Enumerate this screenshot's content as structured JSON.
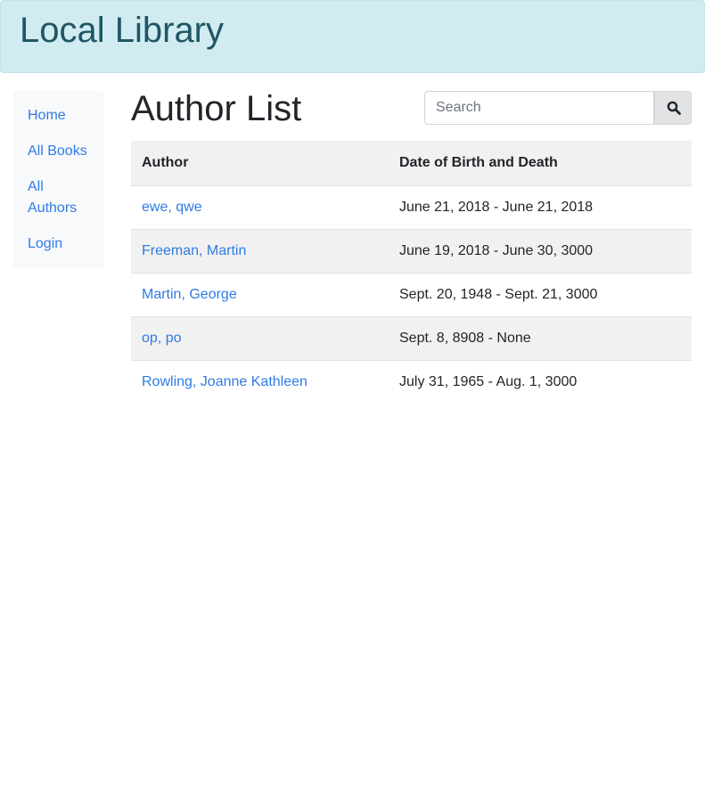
{
  "header": {
    "site_title": "Local Library",
    "banner_color": "#d1ecf1"
  },
  "sidebar": {
    "items": [
      {
        "label": "Home"
      },
      {
        "label": "All Books"
      },
      {
        "label": "All Authors"
      },
      {
        "label": "Login"
      }
    ]
  },
  "main": {
    "page_title": "Author List",
    "search": {
      "placeholder": "Search",
      "button_icon": "search-icon"
    },
    "table": {
      "columns": [
        "Author",
        "Date of Birth and Death"
      ],
      "rows": [
        {
          "author": "ewe, qwe",
          "dates": "June 21, 2018 - June 21, 2018"
        },
        {
          "author": "Freeman, Martin",
          "dates": "June 19, 2018 - June 30, 3000"
        },
        {
          "author": "Martin, George",
          "dates": "Sept. 20, 1948 - Sept. 21, 3000"
        },
        {
          "author": "op, po",
          "dates": "Sept. 8, 8908 - None"
        },
        {
          "author": "Rowling, Joanne Kathleen",
          "dates": "July 31, 1965 - Aug. 1, 3000"
        }
      ]
    }
  },
  "colors": {
    "link": "#2f7be5",
    "stripe": "#f1f1f1"
  }
}
